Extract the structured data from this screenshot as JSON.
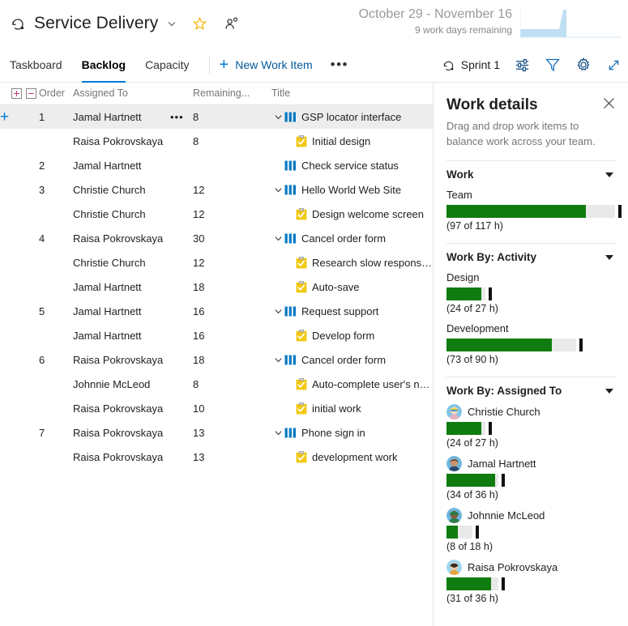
{
  "header": {
    "project_icon": "sprint-icon",
    "project_title": "Service Delivery",
    "chevron_icon": "chevron-down-icon",
    "favorite_icon": "star-icon",
    "team_icon": "person-add-icon",
    "sprint_range": "October 29 - November 16",
    "days_remaining": "9 work days remaining",
    "burndown_icon": "burndown-chart"
  },
  "toolbar": {
    "tabs": [
      {
        "label": "Taskboard",
        "active": false
      },
      {
        "label": "Backlog",
        "active": true
      },
      {
        "label": "Capacity",
        "active": false
      }
    ],
    "new_work_item": "New Work Item",
    "more_icon": "ellipsis-icon",
    "sprint_selector": "Sprint 1",
    "sprint_selector_icon": "sprint-icon",
    "column_options_icon": "column-options-icon",
    "filter_icon": "filter-icon",
    "settings_icon": "gear-icon",
    "fullscreen_icon": "expand-icon"
  },
  "grid": {
    "expand_all_icon": "expand-all-icon",
    "collapse_all_icon": "collapse-all-icon",
    "columns": [
      "Order",
      "Assigned To",
      "Remaining...",
      "Title"
    ],
    "rows": [
      {
        "order": "1",
        "assigned": "Jamal Hartnett",
        "remaining": "8",
        "title": "GSP locator interface",
        "type": "story",
        "indent": 0,
        "chevron": true,
        "selected": true,
        "dots": "•••",
        "add": "+"
      },
      {
        "order": "",
        "assigned": "Raisa Pokrovskaya",
        "remaining": "8",
        "title": "Initial design",
        "type": "task",
        "indent": 1,
        "chevron": false,
        "selected": false
      },
      {
        "order": "2",
        "assigned": "Jamal Hartnett",
        "remaining": "",
        "title": "Check service status",
        "type": "story",
        "indent": 0,
        "chevron": false,
        "selected": false
      },
      {
        "order": "3",
        "assigned": "Christie Church",
        "remaining": "12",
        "title": "Hello World Web Site",
        "type": "story",
        "indent": 0,
        "chevron": true,
        "selected": false
      },
      {
        "order": "",
        "assigned": "Christie Church",
        "remaining": "12",
        "title": "Design welcome screen",
        "type": "task",
        "indent": 1,
        "chevron": false,
        "selected": false
      },
      {
        "order": "4",
        "assigned": "Raisa Pokrovskaya",
        "remaining": "30",
        "title": "Cancel order form",
        "type": "story",
        "indent": 0,
        "chevron": true,
        "selected": false
      },
      {
        "order": "",
        "assigned": "Christie Church",
        "remaining": "12",
        "title": "Research slow response ti...",
        "type": "task",
        "indent": 1,
        "chevron": false,
        "selected": false
      },
      {
        "order": "",
        "assigned": "Jamal Hartnett",
        "remaining": "18",
        "title": "Auto-save",
        "type": "task",
        "indent": 1,
        "chevron": false,
        "selected": false
      },
      {
        "order": "5",
        "assigned": "Jamal Hartnett",
        "remaining": "16",
        "title": "Request support",
        "type": "story",
        "indent": 0,
        "chevron": true,
        "selected": false
      },
      {
        "order": "",
        "assigned": "Jamal Hartnett",
        "remaining": "16",
        "title": "Develop form",
        "type": "task",
        "indent": 1,
        "chevron": false,
        "selected": false
      },
      {
        "order": "6",
        "assigned": "Raisa Pokrovskaya",
        "remaining": "18",
        "title": "Cancel order form",
        "type": "story",
        "indent": 0,
        "chevron": true,
        "selected": false
      },
      {
        "order": "",
        "assigned": "Johnnie McLeod",
        "remaining": "8",
        "title": "Auto-complete user's na...",
        "type": "task",
        "indent": 1,
        "chevron": false,
        "selected": false
      },
      {
        "order": "",
        "assigned": "Raisa Pokrovskaya",
        "remaining": "10",
        "title": "initial work",
        "type": "task",
        "indent": 1,
        "chevron": false,
        "selected": false
      },
      {
        "order": "7",
        "assigned": "Raisa Pokrovskaya",
        "remaining": "13",
        "title": "Phone sign in",
        "type": "story",
        "indent": 0,
        "chevron": true,
        "selected": false
      },
      {
        "order": "",
        "assigned": "Raisa Pokrovskaya",
        "remaining": "13",
        "title": "development work",
        "type": "task",
        "indent": 1,
        "chevron": false,
        "selected": false
      }
    ]
  },
  "details": {
    "title": "Work details",
    "close_icon": "close-icon",
    "subtitle": "Drag and drop work items to balance work across your team.",
    "sections": [
      {
        "title": "Work",
        "caret_icon": "caret-down-icon",
        "items": [
          {
            "label": "Team",
            "value": "(97 of 117 h)",
            "done": 97,
            "capacity": 117
          }
        ]
      },
      {
        "title": "Work By: Activity",
        "caret_icon": "caret-down-icon",
        "items": [
          {
            "label": "Design",
            "value": "(24 of 27 h)",
            "done": 24,
            "capacity": 27
          },
          {
            "label": "Development",
            "value": "(73 of 90 h)",
            "done": 73,
            "capacity": 90
          }
        ]
      },
      {
        "title": "Work By: Assigned To",
        "caret_icon": "caret-down-icon",
        "items": [
          {
            "label": "Christie Church",
            "value": "(24 of 27 h)",
            "done": 24,
            "capacity": 27,
            "avatar": "christie"
          },
          {
            "label": "Jamal Hartnett",
            "value": "(34 of 36 h)",
            "done": 34,
            "capacity": 36,
            "avatar": "jamal"
          },
          {
            "label": "Johnnie McLeod",
            "value": "(8 of 18 h)",
            "done": 8,
            "capacity": 18,
            "avatar": "johnnie"
          },
          {
            "label": "Raisa Pokrovskaya",
            "value": "(31 of 36 h)",
            "done": 31,
            "capacity": 36,
            "avatar": "raisa"
          }
        ]
      }
    ],
    "max_capacity": 117,
    "bar_max_width": 208,
    "colors": {
      "fill": "#107c10",
      "track": "#e9e9e9",
      "tick": "#111111",
      "accent": "#0078d4"
    }
  }
}
